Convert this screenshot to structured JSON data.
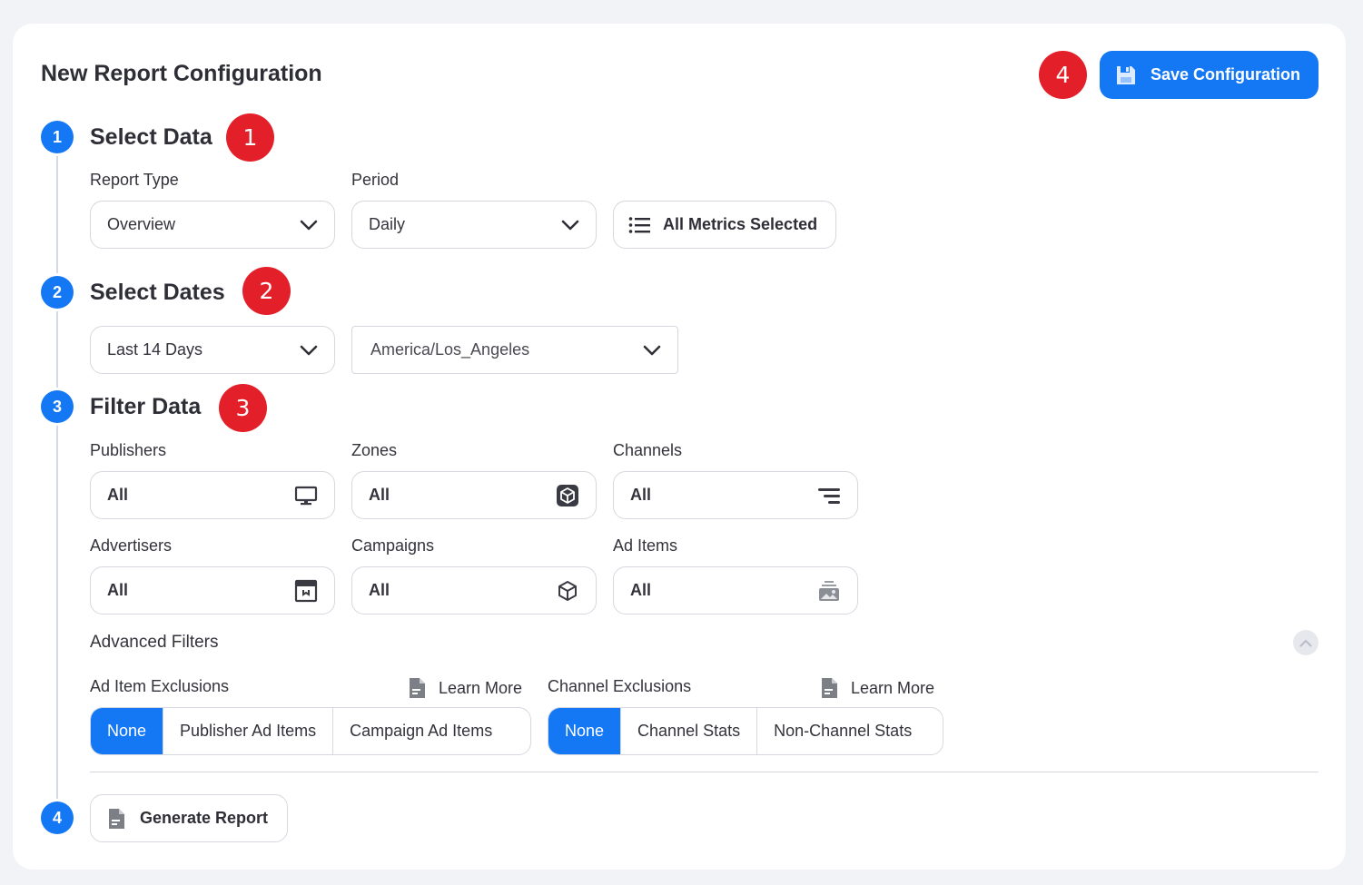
{
  "page_title": "New Report Configuration",
  "save_button": {
    "label": "Save Configuration",
    "icon": "save-icon"
  },
  "annotations": [
    "1",
    "2",
    "3",
    "4"
  ],
  "steps": {
    "select_data": {
      "number": "1",
      "title": "Select Data",
      "report_type": {
        "label": "Report Type",
        "value": "Overview"
      },
      "period": {
        "label": "Period",
        "value": "Daily"
      },
      "metrics_button": {
        "label": "All Metrics Selected",
        "icon": "list-icon"
      }
    },
    "select_dates": {
      "number": "2",
      "title": "Select Dates",
      "range": {
        "value": "Last 14 Days"
      },
      "timezone": {
        "value": "America/Los_Angeles"
      }
    },
    "filter_data": {
      "number": "3",
      "title": "Filter Data",
      "filters": {
        "publishers": {
          "label": "Publishers",
          "value": "All",
          "icon": "monitor-icon"
        },
        "zones": {
          "label": "Zones",
          "value": "All",
          "icon": "cube-filled-icon"
        },
        "channels": {
          "label": "Channels",
          "value": "All",
          "icon": "channels-icon"
        },
        "advertisers": {
          "label": "Advertisers",
          "value": "All",
          "icon": "storefront-icon"
        },
        "campaigns": {
          "label": "Campaigns",
          "value": "All",
          "icon": "cube-outline-icon"
        },
        "ad_items": {
          "label": "Ad Items",
          "value": "All",
          "icon": "image-stack-icon"
        }
      },
      "advanced": {
        "title": "Advanced Filters",
        "ad_item_exclusions": {
          "label": "Ad Item Exclusions",
          "learn_more": "Learn More",
          "options": [
            "None",
            "Publisher Ad Items",
            "Campaign Ad Items"
          ],
          "selected": "None"
        },
        "channel_exclusions": {
          "label": "Channel Exclusions",
          "learn_more": "Learn More",
          "options": [
            "None",
            "Channel Stats",
            "Non-Channel Stats"
          ],
          "selected": "None"
        }
      }
    },
    "generate": {
      "number": "4",
      "button_label": "Generate Report",
      "icon": "document-icon"
    }
  },
  "colors": {
    "primary": "#1478f5",
    "annotation_red": "#e3202a",
    "card": "#ffffff",
    "page_bg": "#f2f3f6"
  }
}
